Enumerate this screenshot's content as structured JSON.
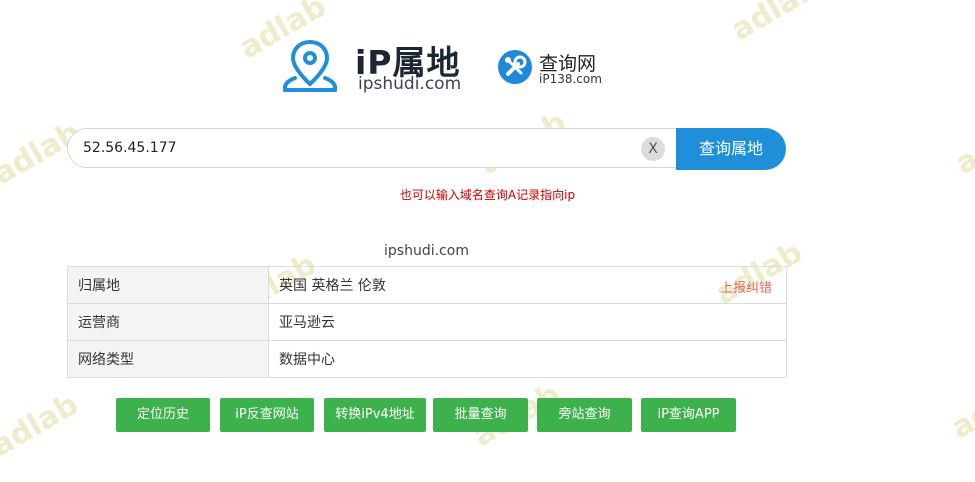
{
  "watermark": "adlab",
  "logo": {
    "title_ip": "iP",
    "title_rest": "属地",
    "subtitle": "ipshudi.com"
  },
  "partner": {
    "title": "查询网",
    "subtitle": "iP138.com"
  },
  "search": {
    "value": "52.56.45.177",
    "clear_label": "X",
    "button_label": "查询属地",
    "hint": "也可以输入域名查询A记录指向ip"
  },
  "result": {
    "domain": "ipshudi.com",
    "report_label": "上报纠错",
    "rows": [
      {
        "key": "归属地",
        "value": "英国 英格兰 伦敦"
      },
      {
        "key": "运营商",
        "value": "亚马逊云"
      },
      {
        "key": "网络类型",
        "value": "数据中心"
      }
    ]
  },
  "actions": [
    {
      "label": "定位历史"
    },
    {
      "label": "iP反查网站"
    },
    {
      "label": "转换iPv4地址"
    },
    {
      "label": "批量查询"
    },
    {
      "label": "旁站查询"
    },
    {
      "label": "iP查询APP"
    }
  ],
  "colors": {
    "brand_blue": "#1e8fd8",
    "action_green": "#3db14b",
    "hint_red": "#cc0000",
    "report_red": "#e06b5d"
  }
}
